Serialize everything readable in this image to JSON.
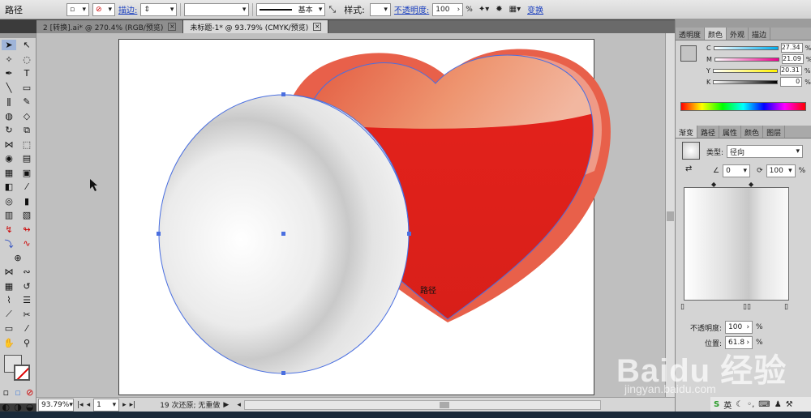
{
  "control_bar": {
    "object_type": "路径",
    "stroke_link": "描边:",
    "brush_label": "基本",
    "style_label": "样式:",
    "opacity_link": "不透明度:",
    "opacity_value": "100",
    "opacity_unit": "%",
    "transform_link": "变换"
  },
  "tabs": [
    {
      "label": "2 [转换].ai* @ 270.4% (RGB/预览)",
      "active": false
    },
    {
      "label": "未标题-1* @ 93.79% (CMYK/预览)",
      "active": true
    }
  ],
  "canvas": {
    "path_label": "路径"
  },
  "status": {
    "zoom": "93.79%",
    "page": "1",
    "history": "19 次还原; 无重做"
  },
  "color_panel": {
    "tabs": [
      "透明度",
      "颜色",
      "外观",
      "描边"
    ],
    "active_tab": "颜色",
    "channels": [
      {
        "key": "C",
        "value": "27.34"
      },
      {
        "key": "M",
        "value": "21.09"
      },
      {
        "key": "Y",
        "value": "20.31"
      },
      {
        "key": "K",
        "value": "0"
      }
    ],
    "unit": "%"
  },
  "gradient_panel": {
    "tabs": [
      "渐变",
      "路径",
      "属性",
      "颜色",
      "图层"
    ],
    "active_tab": "渐变",
    "type_label": "类型:",
    "type_value": "径向",
    "angle_value": "0",
    "aspect_value": "100",
    "opacity_label": "不透明度:",
    "opacity_value": "100",
    "location_label": "位置:",
    "location_value": "61.8",
    "unit": "%"
  },
  "watermark": {
    "main": "Baidu 经验",
    "sub": "jingyan.baidu.com"
  },
  "taskbar": {
    "ime": "英"
  },
  "colors": {
    "accent": "#1a3fbf",
    "heart": "#e0251f",
    "selection": "#4a6fe0"
  }
}
